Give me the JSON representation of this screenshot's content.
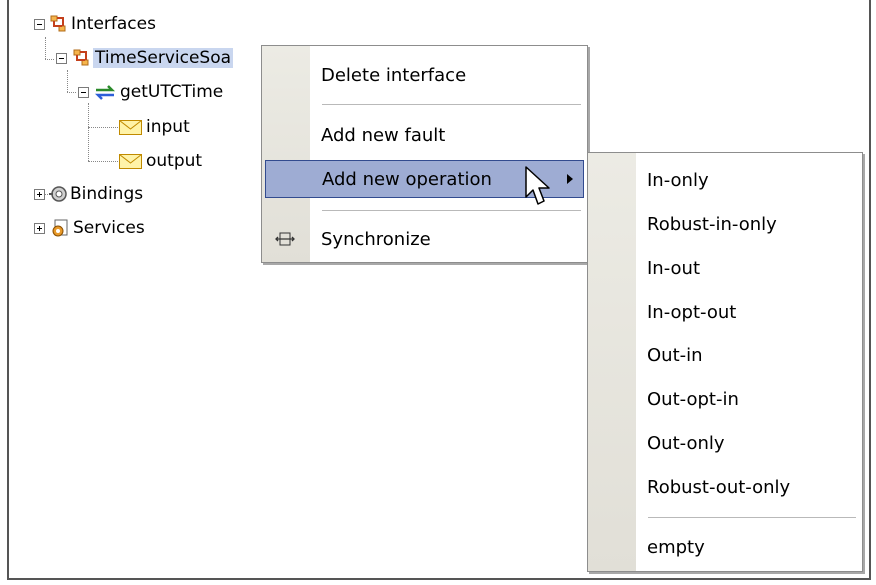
{
  "tree": {
    "interfaces": "Interfaces",
    "time_service": "TimeServiceSoa",
    "get_utc_time": "getUTCTime",
    "input": "input",
    "output": "output",
    "bindings": "Bindings",
    "services": "Services"
  },
  "context_menu": {
    "delete_interface": "Delete interface",
    "add_new_fault": "Add new fault",
    "add_new_operation": "Add new operation",
    "synchronize": "Synchronize"
  },
  "submenu": {
    "items": [
      "In-only",
      "Robust-in-only",
      "In-out",
      "In-opt-out",
      "Out-in",
      "Out-opt-in",
      "Out-only",
      "Robust-out-only"
    ],
    "empty": "empty"
  },
  "colors": {
    "highlight": "#9eacd3",
    "selection": "#c9d6ef",
    "gutter": "#e5e3db"
  },
  "icons": {
    "interfaces": "interface-icon",
    "operation": "operation-arrows-icon",
    "message": "envelope-icon",
    "bindings": "binding-icon",
    "services": "service-icon",
    "synchronize": "synchronize-icon",
    "cursor": "mouse-cursor-icon"
  }
}
